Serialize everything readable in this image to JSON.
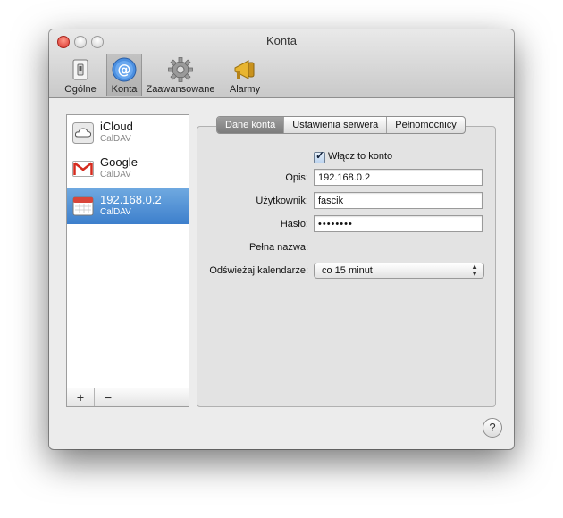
{
  "window": {
    "title": "Konta"
  },
  "toolbar": {
    "items": [
      {
        "label": "Ogólne",
        "icon": "switch-icon"
      },
      {
        "label": "Konta",
        "icon": "at-icon"
      },
      {
        "label": "Zaawansowane",
        "icon": "gear-icon"
      },
      {
        "label": "Alarmy",
        "icon": "megaphone-icon"
      }
    ],
    "active": "Konta"
  },
  "accounts": [
    {
      "name": "iCloud",
      "type": "CalDAV",
      "icon": "cloud-icon"
    },
    {
      "name": "Google",
      "type": "CalDAV",
      "icon": "gmail-icon"
    },
    {
      "name": "192.168.0.2",
      "type": "CalDAV",
      "icon": "calendar-icon",
      "selected": true
    }
  ],
  "list_footer": {
    "add": "+",
    "remove": "−"
  },
  "tabs": [
    "Dane konta",
    "Ustawienia serwera",
    "Pełnomocnicy"
  ],
  "form": {
    "enable_label": "Włącz to konto",
    "enable_checked": true,
    "opis_label": "Opis:",
    "opis_value": "192.168.0.2",
    "user_label": "Użytkownik:",
    "user_value": "fascik",
    "pass_label": "Hasło:",
    "pass_value": "••••••••",
    "fullname_label": "Pełna nazwa:",
    "refresh_label": "Odświeżaj kalendarze:",
    "refresh_value": "co 15 minut"
  },
  "help": "?",
  "colors": {
    "selection": "#3d7fcc",
    "close_button": "#d9302a"
  }
}
